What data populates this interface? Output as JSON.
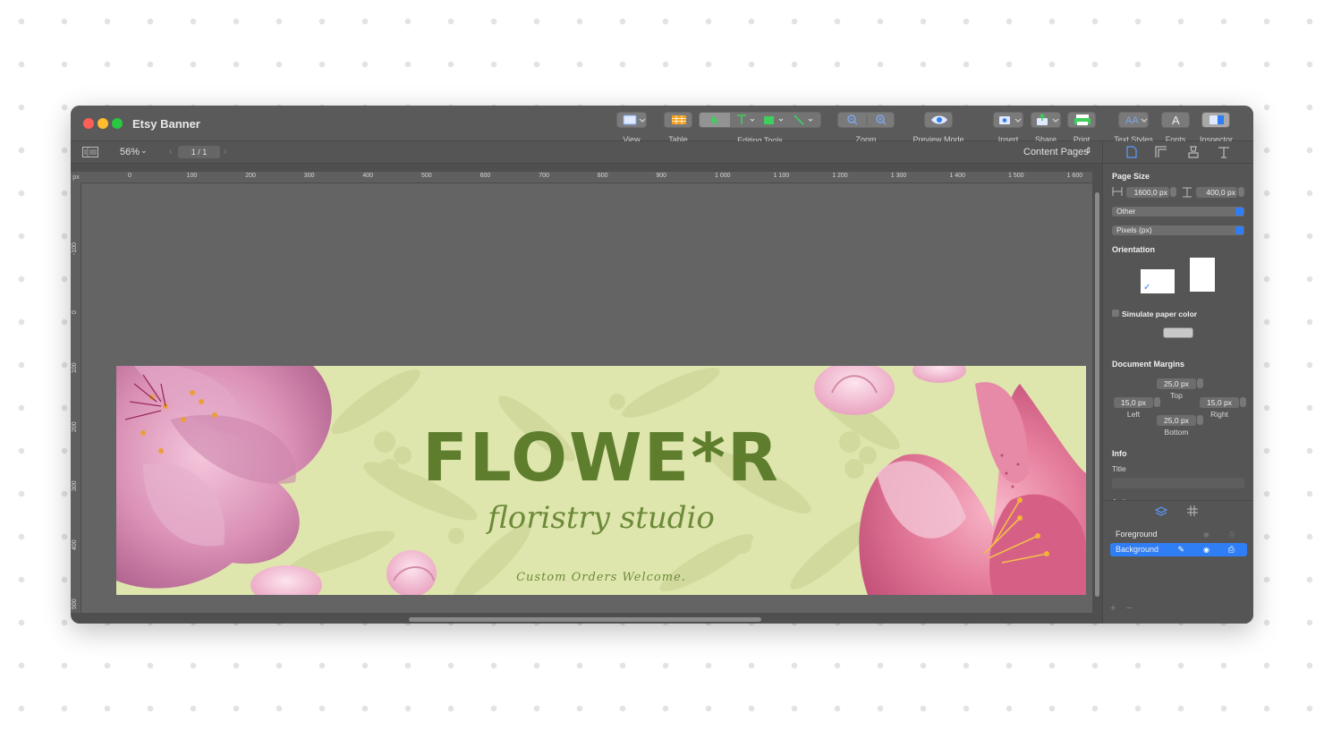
{
  "window": {
    "title": "Etsy Banner"
  },
  "toolbar": [
    {
      "label": "View",
      "icon": "view-icon"
    },
    {
      "label": "Table",
      "icon": "table-icon"
    },
    {
      "label": "Editing Tools",
      "icon": "editing-tools-icon"
    },
    {
      "label": "Zoom",
      "icon": "zoom-icon"
    },
    {
      "label": "Preview Mode",
      "icon": "eye-icon"
    },
    {
      "label": "Insert",
      "icon": "insert-icon"
    },
    {
      "label": "Share",
      "icon": "share-icon"
    },
    {
      "label": "Print",
      "icon": "printer-icon"
    },
    {
      "label": "Text Styles",
      "icon": "text-styles-icon"
    },
    {
      "label": "Fonts",
      "icon": "fonts-icon"
    },
    {
      "label": "Inspector",
      "icon": "inspector-icon"
    }
  ],
  "toolbar2": {
    "zoom": "56%",
    "page": "1 / 1",
    "content_pages": "Content Pages"
  },
  "ruler": {
    "unit": "px",
    "h_ticks": [
      "0",
      "100",
      "200",
      "300",
      "400",
      "500",
      "600",
      "700",
      "800",
      "900",
      "1 000",
      "1 100",
      "1 200",
      "1 300",
      "1 400",
      "1 500",
      "1 600"
    ],
    "v_ticks": [
      "-100",
      "0",
      "100",
      "200",
      "300",
      "400",
      "500"
    ]
  },
  "banner": {
    "title": "FLOWE*R",
    "subtitle": "floristry studio",
    "tagline": "Custom Orders Welcome."
  },
  "inspector": {
    "page_size_label": "Page Size",
    "width": "1600,0 px",
    "height": "400,0 px",
    "preset": "Other",
    "units": "Pixels (px)",
    "orientation_label": "Orientation",
    "simulate_paper_color": "Simulate paper color",
    "margins_label": "Document Margins",
    "margin_top": "25,0 px",
    "margin_top_label": "Top",
    "margin_left": "15,0 px",
    "margin_left_label": "Left",
    "margin_right": "15,0 px",
    "margin_right_label": "Right",
    "margin_bottom": "25,0 px",
    "margin_bottom_label": "Bottom",
    "info_label": "Info",
    "title_label": "Title",
    "author_label": "Author"
  },
  "layers": [
    {
      "name": "Foreground",
      "selected": false
    },
    {
      "name": "Background",
      "selected": true
    }
  ],
  "colors": {
    "accent": "#2f7ef6",
    "banner_bg": "#dfe6ad",
    "banner_text": "#5e7e2e"
  }
}
